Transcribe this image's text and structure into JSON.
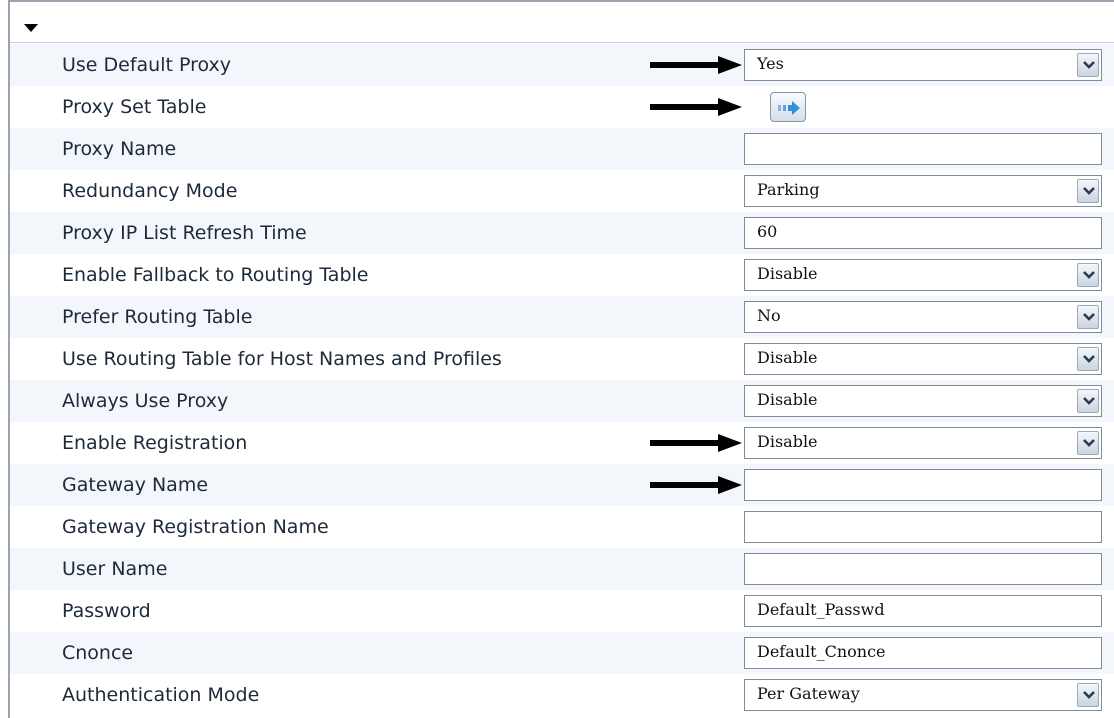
{
  "section": {
    "collapse_icon": "triangle-down-icon"
  },
  "fields": [
    {
      "label": "Use Default Proxy",
      "type": "select",
      "value": "Yes",
      "arrow": true
    },
    {
      "label": "Proxy Set Table",
      "type": "button",
      "icon": "arrow-right-icon",
      "arrow": true
    },
    {
      "label": "Proxy Name",
      "type": "text",
      "value": ""
    },
    {
      "label": "Redundancy Mode",
      "type": "select",
      "value": "Parking"
    },
    {
      "label": "Proxy IP List Refresh Time",
      "type": "text",
      "value": "60"
    },
    {
      "label": "Enable Fallback to Routing Table",
      "type": "select",
      "value": "Disable"
    },
    {
      "label": "Prefer Routing Table",
      "type": "select",
      "value": "No"
    },
    {
      "label": "Use Routing Table for Host Names and Profiles",
      "type": "select",
      "value": "Disable"
    },
    {
      "label": "Always Use Proxy",
      "type": "select",
      "value": "Disable"
    },
    {
      "label": "Enable Registration",
      "type": "select",
      "value": "Disable",
      "arrow": true
    },
    {
      "label": "Gateway Name",
      "type": "text",
      "value": "",
      "arrow": true
    },
    {
      "label": "Gateway Registration Name",
      "type": "text",
      "value": ""
    },
    {
      "label": "User Name",
      "type": "text",
      "value": ""
    },
    {
      "label": "Password",
      "type": "text",
      "value": "Default_Passwd"
    },
    {
      "label": "Cnonce",
      "type": "text",
      "value": "Default_Cnonce"
    },
    {
      "label": "Authentication Mode",
      "type": "select",
      "value": "Per Gateway"
    }
  ],
  "colors": {
    "row_alt": "#f3f7fb",
    "label_text": "#1d2a3a",
    "button_accent": "#2f8ee0"
  }
}
